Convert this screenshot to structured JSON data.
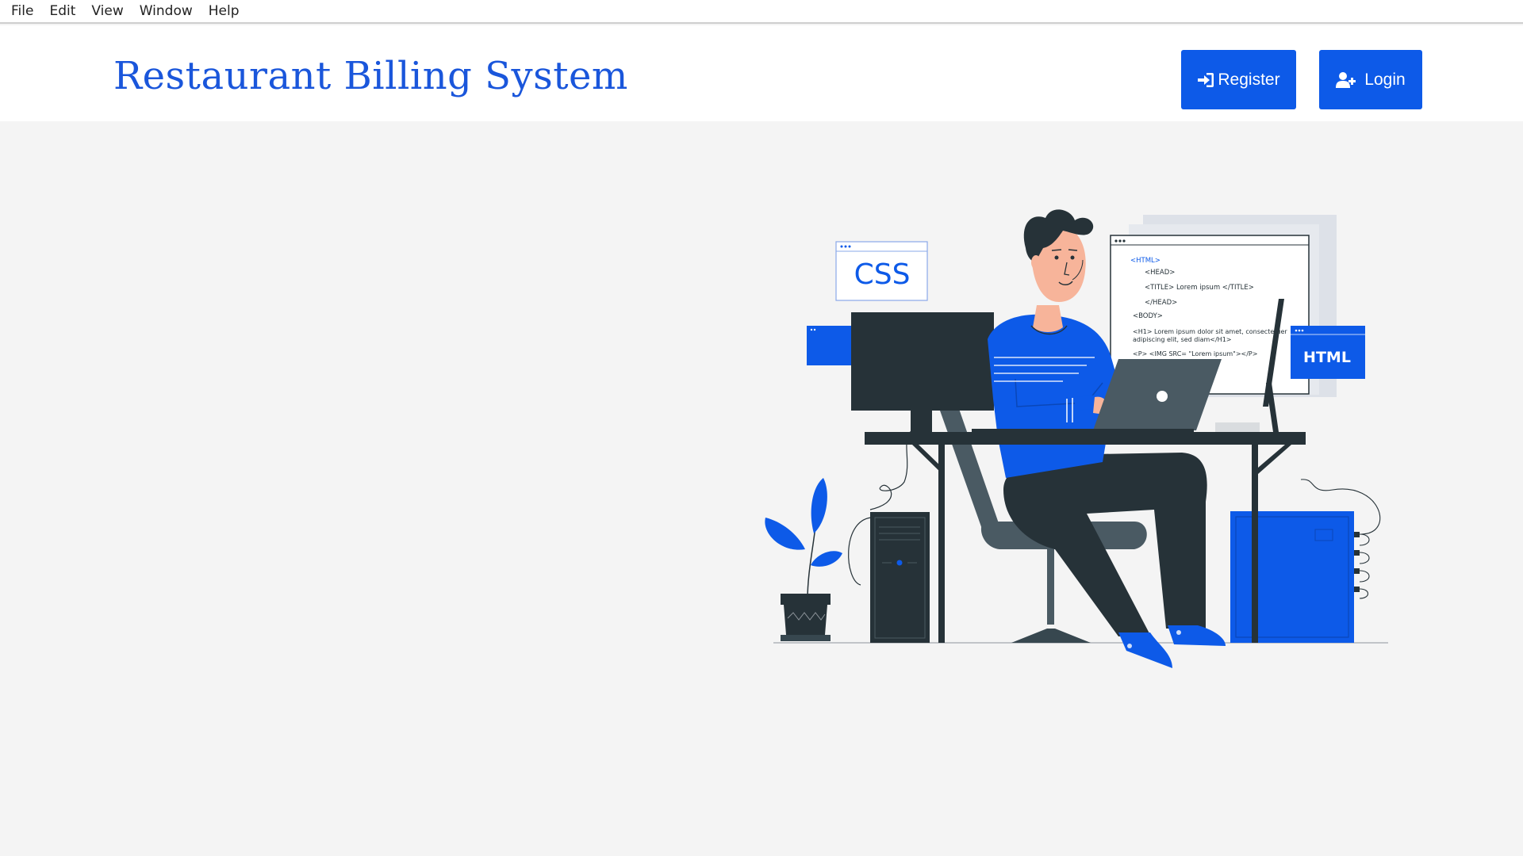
{
  "menubar": {
    "items": [
      "File",
      "Edit",
      "View",
      "Window",
      "Help"
    ]
  },
  "header": {
    "title": "Restaurant Billing System",
    "register_label": "Register",
    "login_label": "Login"
  },
  "illustration": {
    "css_label": "CSS",
    "html_label": "HTML",
    "code_lines": [
      "<HTML>",
      "<HEAD>",
      "<TITLE> Lorem ipsum </TITLE>",
      "</HEAD>",
      "<BODY>",
      "<H1> Lorem ipsum dolor sit amet, consectetuer",
      "adipiscing elit, sed diam</H1>",
      "<P> <IMG SRC= \"Lorem ipsum\"></P>"
    ]
  },
  "colors": {
    "accent": "#0d5ae8",
    "title": "#1a56db",
    "dark": "#263238",
    "background": "#f4f4f4"
  }
}
